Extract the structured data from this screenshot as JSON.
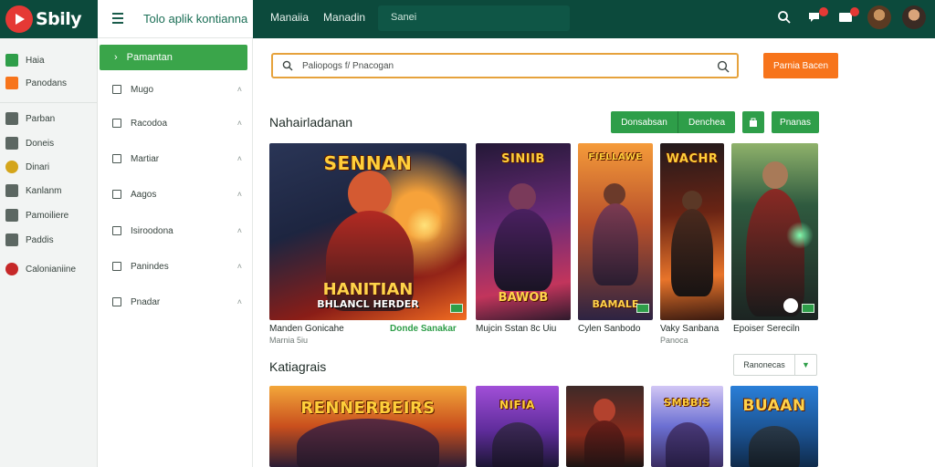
{
  "app": {
    "logo_text": "Sbily",
    "title": "Tolo aplik kontianna"
  },
  "topnav": {
    "items": [
      "Manaiia",
      "Manadin"
    ],
    "search_placeholder": "Sanei"
  },
  "sidebar": {
    "items": [
      {
        "label": "Haia",
        "icon": "home-icon",
        "color": "#2e9e49"
      },
      {
        "label": "Panodans",
        "icon": "bookmark-icon",
        "color": "#f7741b"
      },
      {
        "label": "Parban",
        "icon": "grid-icon",
        "color": "#5c6762"
      },
      {
        "label": "Doneis",
        "icon": "package-icon",
        "color": "#5c6762"
      },
      {
        "label": "Dinari",
        "icon": "coin-icon",
        "color": "#d4a51b"
      },
      {
        "label": "Kanlanm",
        "icon": "edit-icon",
        "color": "#5c6762"
      },
      {
        "label": "Pamoiliere",
        "icon": "link-icon",
        "color": "#5c6762"
      },
      {
        "label": "Paddis",
        "icon": "card-icon",
        "color": "#5c6762"
      },
      {
        "label": "Calonianiine",
        "icon": "record-icon",
        "color": "#c62828"
      }
    ]
  },
  "sidebar2": {
    "active_label": "Pamantan",
    "items": [
      {
        "label": "Mugo",
        "icon": "folder-icon"
      },
      {
        "label": "Racodoa",
        "icon": "list-icon"
      },
      {
        "label": "Martiar",
        "icon": "tag-icon"
      },
      {
        "label": "Aagos",
        "icon": "box-icon"
      },
      {
        "label": "Isiroodona",
        "icon": "window-icon"
      },
      {
        "label": "Panindes",
        "icon": "doc-icon"
      },
      {
        "label": "Pnadar",
        "icon": "page-icon"
      }
    ]
  },
  "search": {
    "placeholder": "Paliopogs f/ Pnacogan",
    "button_label": "Parnia Bacen"
  },
  "section1": {
    "title": "Nahairladanan",
    "buttons": [
      "Donsabsan",
      "Denchea",
      "Pnanas"
    ],
    "cards": [
      {
        "top": "SENNAN",
        "bottom": "HANITIAN",
        "sub": "BHLANCL HERDER",
        "art": [
          "#f36d21",
          "#8a1d17",
          "#1d2540"
        ]
      },
      {
        "top": "SINIIB",
        "bottom": "BAWOB",
        "sub": "",
        "art": [
          "#6b2b7a",
          "#c2355c",
          "#231836"
        ]
      },
      {
        "top": "FIELLAWE",
        "bottom": "BAMALE",
        "sub": "",
        "art": [
          "#f59b3a",
          "#b8502a",
          "#2d2342"
        ]
      },
      {
        "top": "WACHR",
        "bottom": "",
        "sub": "",
        "art": [
          "#e8742a",
          "#6a2414",
          "#221a1c"
        ]
      },
      {
        "top": "",
        "bottom": "",
        "sub": "",
        "art": [
          "#8fb26b",
          "#2f5a3f",
          "#1c2422"
        ]
      }
    ],
    "captions": [
      {
        "title": "Manden Gonicahe",
        "meta": "Marnia 5iu"
      },
      {
        "title": "Donde Sanakar"
      },
      {
        "title": "Mujcin Sstan 8c Uiu"
      },
      {
        "title": "Cylen Sanbodo"
      },
      {
        "title": "Vaky Sanbana",
        "meta": "Panoca"
      },
      {
        "title": "Epoiser Sereciln"
      }
    ]
  },
  "section2": {
    "title": "Katiagrais",
    "sort_label": "Ranonecas",
    "cards": [
      {
        "top": "RENNERBEIRS",
        "art": [
          "#f3a73a",
          "#c94f1d",
          "#2b1d34"
        ]
      },
      {
        "top": "NIFIA",
        "art": [
          "#a14fd8",
          "#5f2c9b",
          "#1c1634"
        ]
      },
      {
        "top": "",
        "art": [
          "#3e2a28",
          "#8b2b1c",
          "#1b1413"
        ]
      },
      {
        "top": "SMBBIS",
        "art": [
          "#6b6fd2",
          "#d2c7f5",
          "#3b2d61"
        ]
      },
      {
        "top": "BUAAN",
        "art": [
          "#2a7fd8",
          "#1a4f8c",
          "#e0a12c"
        ]
      }
    ]
  },
  "colors": {
    "brand": "#0c4a3c",
    "accent_green": "#2e9e49",
    "accent_orange": "#f7741b"
  }
}
